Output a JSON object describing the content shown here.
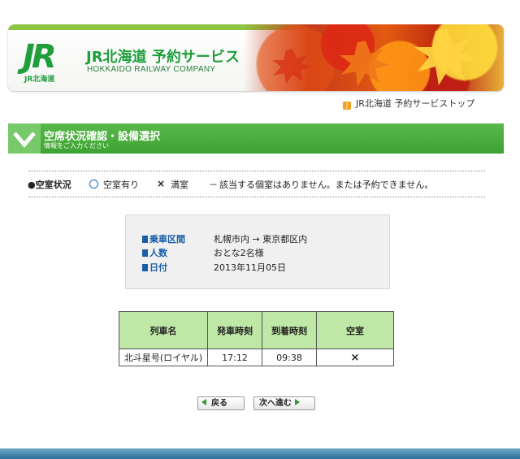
{
  "header": {
    "logo_mark": "JR",
    "logo_sub": "JR北海道",
    "title": "JR北海道 予約サービス",
    "subtitle": "HOKKAIDO RAILWAY COMPANY"
  },
  "top_link": {
    "label": "JR北海道 予約サービストップ",
    "icon": "J"
  },
  "section": {
    "title": "空席状況確認・設備選択",
    "subtitle": "情報をご入力ください"
  },
  "legend": {
    "title": "●空室状況",
    "vacant_label": "空室有り",
    "full_symbol": "×",
    "full_label": "満室",
    "none_symbol": "－",
    "none_label": "該当する個室はありません。または予約できません。"
  },
  "trip_info": {
    "section_label": "乗車区間",
    "section_value": "札幌市内 → 東京都区内",
    "people_label": "人数",
    "people_value": "おとな2名様",
    "date_label": "日付",
    "date_value": "2013年11月05日"
  },
  "table": {
    "headers": [
      "列車名",
      "発車時刻",
      "到着時刻",
      "空室"
    ],
    "rows": [
      {
        "train": "北斗星号(ロイヤル)",
        "depart": "17:12",
        "arrive": "09:38",
        "vacancy": "×"
      }
    ]
  },
  "nav": {
    "back_label": "戻る",
    "next_label": "次へ進む"
  },
  "colors": {
    "brand_green": "#1f9e3c",
    "section_green": "#3da232",
    "table_header": "#bfe8a6",
    "label_blue": "#1a5ea8"
  }
}
